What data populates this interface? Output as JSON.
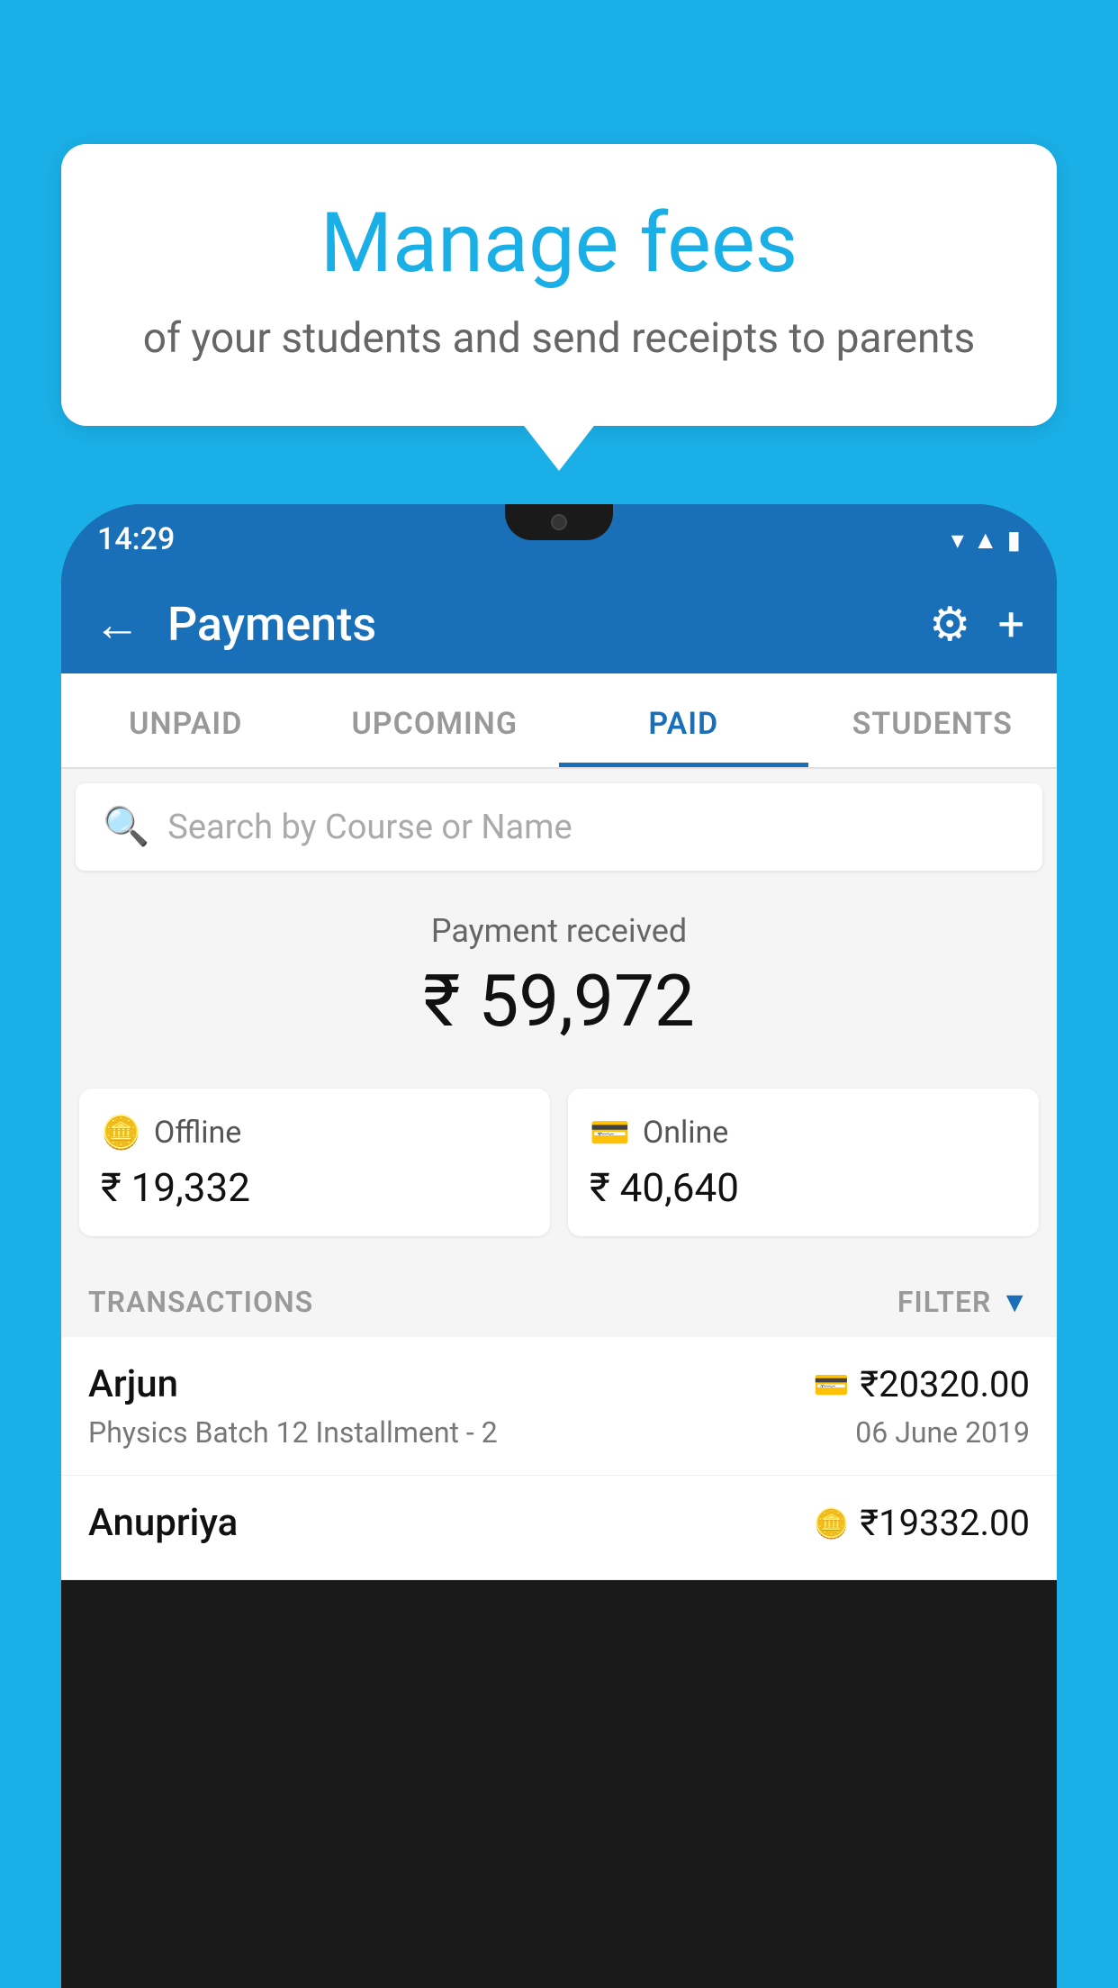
{
  "background": {
    "color": "#1AAFE6"
  },
  "bubble": {
    "title": "Manage fees",
    "subtitle": "of your students and send receipts to parents"
  },
  "phone": {
    "status_bar": {
      "time": "14:29"
    },
    "app_bar": {
      "title": "Payments",
      "back_label": "←",
      "gear_label": "⚙",
      "plus_label": "+"
    },
    "tabs": [
      {
        "label": "UNPAID",
        "active": false
      },
      {
        "label": "UPCOMING",
        "active": false
      },
      {
        "label": "PAID",
        "active": true
      },
      {
        "label": "STUDENTS",
        "active": false
      }
    ],
    "search": {
      "placeholder": "Search by Course or Name"
    },
    "payment_summary": {
      "label": "Payment received",
      "amount": "₹ 59,972",
      "offline": {
        "label": "Offline",
        "amount": "₹ 19,332"
      },
      "online": {
        "label": "Online",
        "amount": "₹ 40,640"
      }
    },
    "transactions": {
      "header_label": "TRANSACTIONS",
      "filter_label": "FILTER",
      "items": [
        {
          "name": "Arjun",
          "amount": "₹20320.00",
          "course": "Physics Batch 12 Installment - 2",
          "date": "06 June 2019",
          "payment_type": "online"
        },
        {
          "name": "Anupriya",
          "amount": "₹19332.00",
          "course": "",
          "date": "",
          "payment_type": "offline"
        }
      ]
    }
  }
}
